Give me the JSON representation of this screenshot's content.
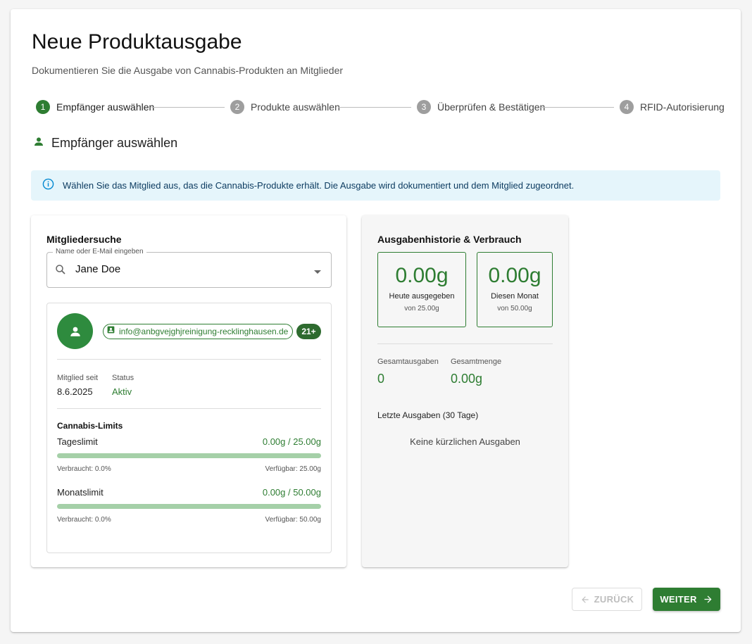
{
  "page": {
    "title": "Neue Produktausgabe",
    "subtitle": "Dokumentieren Sie die Ausgabe von Cannabis-Produkten an Mitglieder"
  },
  "stepper": [
    {
      "number": "1",
      "label": "Empfänger auswählen",
      "active": true
    },
    {
      "number": "2",
      "label": "Produkte auswählen",
      "active": false
    },
    {
      "number": "3",
      "label": "Überprüfen & Bestätigen",
      "active": false
    },
    {
      "number": "4",
      "label": "RFID-Autorisierung",
      "active": false
    }
  ],
  "section": {
    "title": "Empfänger auswählen",
    "icon": "person-icon"
  },
  "alert": {
    "icon": "info-icon",
    "text": "Wählen Sie das Mitglied aus, das die Cannabis-Produkte erhält. Die Ausgabe wird dokumentiert und dem Mitglied zugeordnet."
  },
  "member_search": {
    "title": "Mitgliedersuche",
    "field_label": "Name oder E-Mail eingeben",
    "value": "Jane Doe"
  },
  "member": {
    "email": "info@anbgvejghjreinigung-recklinghausen.de",
    "age_badge": "21+",
    "member_since_label": "Mitglied seit",
    "member_since": "8.6.2025",
    "status_label": "Status",
    "status": "Aktiv",
    "limits_title": "Cannabis-Limits",
    "daily": {
      "label": "Tageslimit",
      "value": "0.00g / 25.00g",
      "used": "Verbraucht: 0.0%",
      "available": "Verfügbar: 25.00g",
      "fraction": 0.0
    },
    "monthly": {
      "label": "Monatslimit",
      "value": "0.00g / 50.00g",
      "used": "Verbraucht: 0.0%",
      "available": "Verfügbar: 50.00g",
      "fraction": 0.0
    }
  },
  "history": {
    "title": "Ausgabenhistorie & Verbrauch",
    "today": {
      "value": "0.00g",
      "label": "Heute ausgegeben",
      "sub": "von 25.00g"
    },
    "month": {
      "value": "0.00g",
      "label": "Diesen Monat",
      "sub": "von 50.00g"
    },
    "total_label": "Gesamtausgaben",
    "total_value": "0",
    "amount_label": "Gesamtmenge",
    "amount_value": "0.00g",
    "recent_label": "Letzte Ausgaben (30 Tage)",
    "empty_text": "Keine kürzlichen Ausgaben"
  },
  "buttons": {
    "back": "ZURÜCK",
    "next": "WEITER"
  },
  "colors": {
    "primary": "#2e7d32",
    "info_bg": "#e5f5fb",
    "info_text": "#0d3c61",
    "bar": "#a5d0a8"
  }
}
